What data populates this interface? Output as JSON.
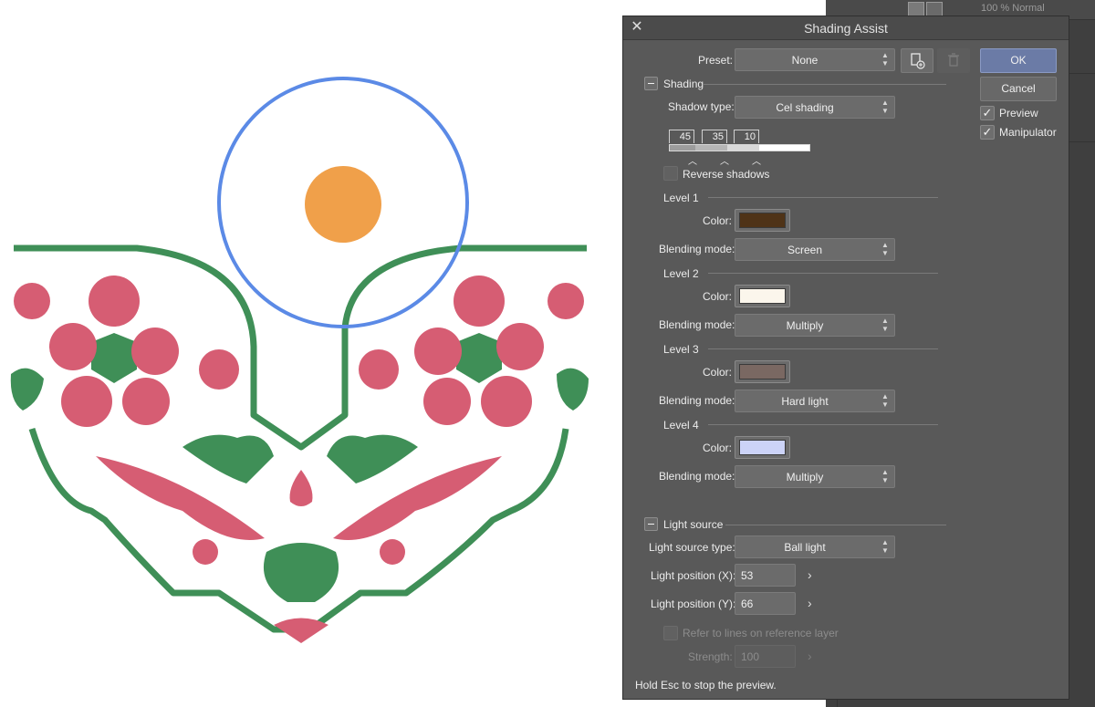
{
  "layers_panel": {
    "top_layer_text": "100 % Normal"
  },
  "dialog": {
    "title": "Shading Assist",
    "preset": {
      "label": "Preset:",
      "value": "None"
    },
    "buttons": {
      "ok": "OK",
      "cancel": "Cancel"
    },
    "options": {
      "preview": "Preview",
      "manipulator": "Manipulator",
      "preview_checked": true,
      "manipulator_checked": true
    },
    "shading": {
      "section": "Shading",
      "shadow_type_label": "Shadow type:",
      "shadow_type": "Cel shading",
      "thresholds": [
        "45",
        "35",
        "10"
      ],
      "reverse_shadows": "Reverse shadows",
      "levels": [
        {
          "name": "Level 1",
          "color_label": "Color:",
          "color": "#4f3317",
          "blend_label": "Blending mode:",
          "blend": "Screen"
        },
        {
          "name": "Level 2",
          "color_label": "Color:",
          "color": "#fbf6ec",
          "blend_label": "Blending mode:",
          "blend": "Multiply"
        },
        {
          "name": "Level 3",
          "color_label": "Color:",
          "color": "#7a6862",
          "blend_label": "Blending mode:",
          "blend": "Hard light"
        },
        {
          "name": "Level 4",
          "color_label": "Color:",
          "color": "#ccd3f7",
          "blend_label": "Blending mode:",
          "blend": "Multiply"
        }
      ]
    },
    "light_source": {
      "section": "Light source",
      "type_label": "Light source type:",
      "type": "Ball light",
      "pos_x_label": "Light position (X):",
      "pos_x": "53",
      "pos_y_label": "Light position (Y):",
      "pos_y": "66",
      "refer_lines": "Refer to lines on reference layer",
      "strength_label": "Strength:",
      "strength": "100"
    },
    "footer_hint": "Hold Esc to stop the preview."
  },
  "colors": {
    "light_circle": "#5b8ae6",
    "light_ball": "#f0a04a",
    "ornament_green": "#3f8f57",
    "ornament_pink": "#d65d73",
    "ok_accent": "#6b7ba6"
  }
}
